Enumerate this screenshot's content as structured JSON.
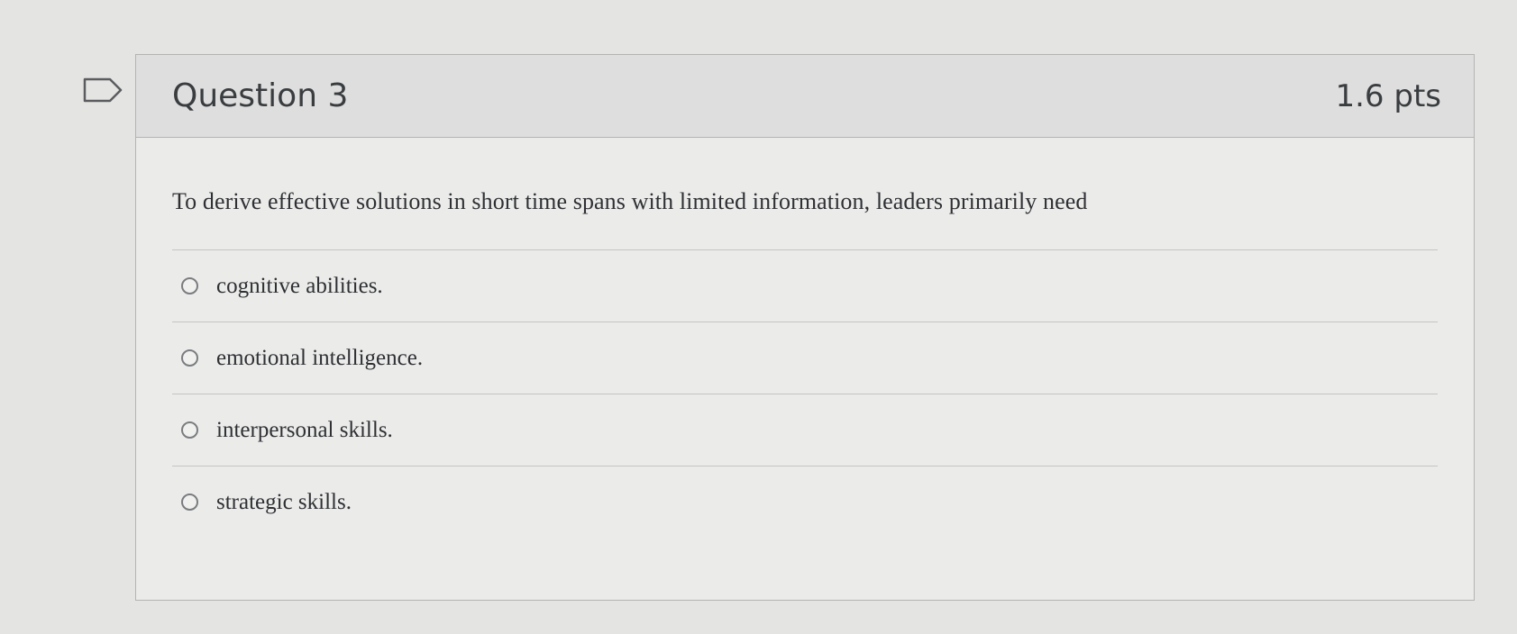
{
  "question": {
    "title": "Question 3",
    "points": "1.6 pts",
    "text": "To derive effective solutions in short time spans with limited information, leaders primarily need",
    "answers": [
      {
        "label": "cognitive abilities.",
        "selected": false
      },
      {
        "label": "emotional intelligence.",
        "selected": false
      },
      {
        "label": "interpersonal skills.",
        "selected": false
      },
      {
        "label": "strategic skills.",
        "selected": false
      }
    ]
  },
  "icons": {
    "flag": "flag-outline-icon"
  }
}
